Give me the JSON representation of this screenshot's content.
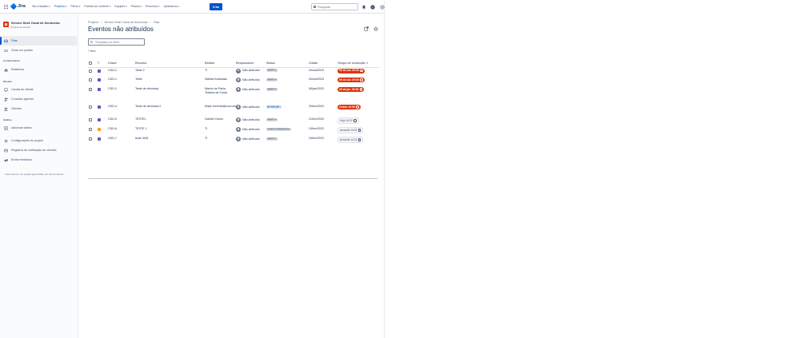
{
  "topnav": {
    "app_name": "Jira",
    "items": [
      {
        "label": "Seu trabalho",
        "active": false
      },
      {
        "label": "Projetos",
        "active": true
      },
      {
        "label": "Filtros",
        "active": false
      },
      {
        "label": "Painéis de controle",
        "active": false
      },
      {
        "label": "Equipes",
        "active": false
      },
      {
        "label": "Planos",
        "active": false
      },
      {
        "label": "Recursos",
        "active": false
      },
      {
        "label": "Aplicativos",
        "active": false
      }
    ],
    "create_label": "Criar",
    "search_placeholder": "Pesquisar"
  },
  "sidebar": {
    "project_name": "Service Desk Canal de Denúncias",
    "project_type": "Projeto de serviço",
    "items": [
      {
        "label": "Filas",
        "icon": "queue-icon"
      },
      {
        "label": "Gerar um pedido",
        "icon": "ticket-icon"
      },
      {
        "label": "Relatórios",
        "icon": "chart-icon"
      },
      {
        "label": "Canais do cliente",
        "icon": "monitor-icon"
      },
      {
        "label": "Convidar agentes",
        "icon": "add-person-icon"
      },
      {
        "label": "Clientes",
        "icon": "people-icon"
      },
      {
        "label": "Adicionar atalho",
        "icon": "add-shortcut-icon"
      },
      {
        "label": "Configurações do projeto",
        "icon": "gear-icon"
      },
      {
        "label": "Registros de notificação de clientes",
        "icon": "mail-icon"
      },
      {
        "label": "Enviar feedback",
        "icon": "megaphone-icon"
      }
    ],
    "sections": {
      "knowledge": "Conhecimento",
      "channels": "Direitos",
      "shortcuts": "Atalhos"
    },
    "footer": "Você está em um projeto gerenciado por uma empresa"
  },
  "main": {
    "breadcrumb": [
      "Projetos",
      "Service Desk Canal de Denúncias",
      "Filas"
    ],
    "title": "Eventos não atribuídos",
    "search_placeholder": "Pesquisar por itens",
    "item_count": "7 itens",
    "columns": [
      "T",
      "Chave",
      "Resumo",
      "Relator",
      "Responsável",
      "Status",
      "Criado",
      "Tempo de resolução"
    ],
    "rows": [
      {
        "type": "purple",
        "key": "CDD-2",
        "summary": "Teste 2",
        "reporter": "TI",
        "assignee": "Não atribuído",
        "status": "ABERTO",
        "status_style": "grey",
        "created": "04/out/2023",
        "sla": "09 de out. 09:00",
        "sla_style": "red"
      },
      {
        "type": "purple",
        "key": "CDD-1",
        "summary": "Teste",
        "reporter": "Nathan Anastasio",
        "assignee": "Não atribuído",
        "status": "ABERTO",
        "status_style": "grey",
        "created": "04/out/2023",
        "sla": "09 de out. 09:00",
        "sla_style": "red"
      },
      {
        "type": "purple",
        "key": "CDD-3",
        "summary": "Teste de denúncia",
        "reporter": "Marcio de Paula Teixeira da Costa",
        "assignee": "Não atribuído",
        "status": "ABERTO",
        "status_style": "grey",
        "created": "06/jan/2023",
        "sla": "09 de jan. 09:00",
        "sla_style": "red"
      },
      {
        "type": "purple",
        "key": "CDD-4",
        "summary": "Teste de denúncia 2",
        "reporter": "felipe.rezende@ccsi.com.br",
        "assignee": "Não atribuído",
        "status": "EM ANÁLISE",
        "status_style": "blue",
        "created": "20/fev/2023",
        "sla": "Ontem 12:55",
        "sla_style": "red"
      },
      {
        "type": "purple",
        "key": "CDD-5",
        "summary": "TESTE1",
        "reporter": "Gabriel Cortez",
        "assignee": "Não atribuído",
        "status": "ABERTO",
        "status_style": "grey",
        "created": "21/fev/2023",
        "sla": "Hoje 16:32",
        "sla_style": "grey"
      },
      {
        "type": "orange",
        "key": "CDD-6",
        "summary": "TESTE 1",
        "reporter": "TI",
        "assignee": "Não atribuído",
        "status": "TAREFAS PENDENTES",
        "status_style": "grey",
        "created": "24/fev/2023",
        "sla": "Amanhã 13:03",
        "sla_style": "grey"
      },
      {
        "type": "purple",
        "key": "CDD-7",
        "summary": "teste 3001",
        "reporter": "TI",
        "assignee": "Não atribuído",
        "status": "ABERTO",
        "status_style": "grey",
        "created": "24/fev/2023",
        "sla": "Amanhã 14:23",
        "sla_style": "grey"
      }
    ]
  },
  "colors": {
    "brand": "#0052cc",
    "sla_breached": "#de350b",
    "type_purple": "#6554c0",
    "type_orange": "#ff991f"
  }
}
